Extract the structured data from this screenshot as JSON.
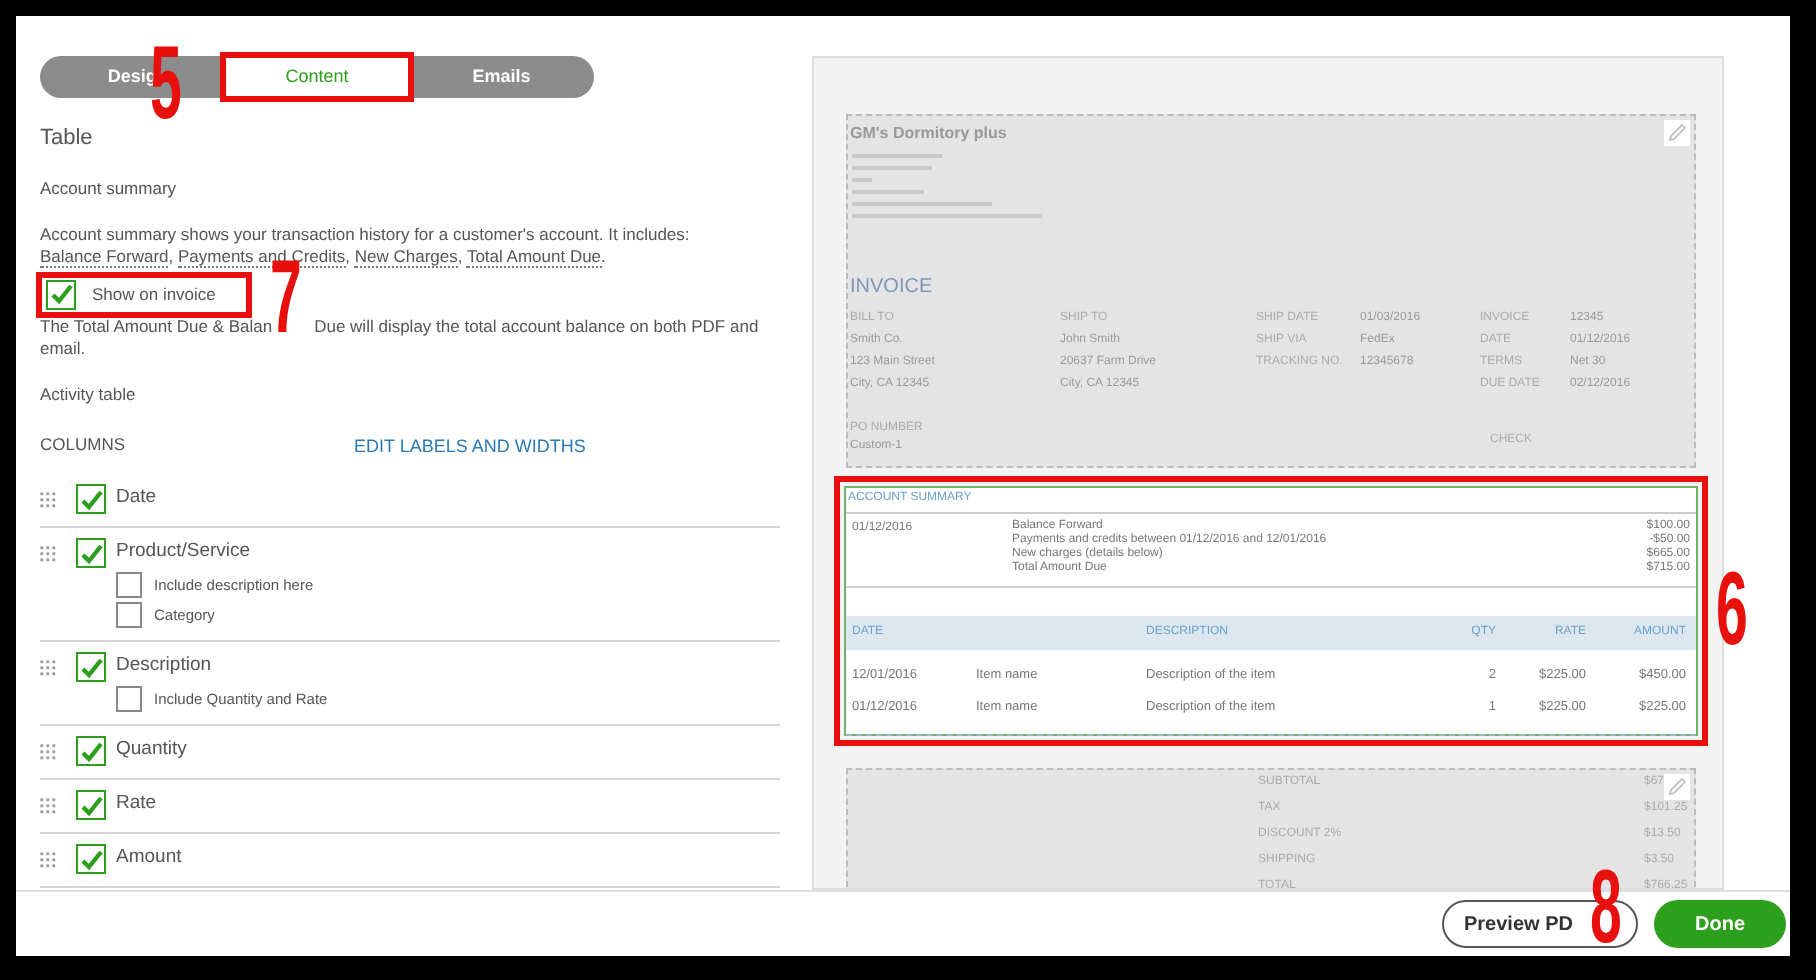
{
  "tabs": [
    {
      "label": "Desig",
      "selected": false,
      "highlighted": false
    },
    {
      "label": "Content",
      "selected": true,
      "highlighted": true
    },
    {
      "label": "Emails",
      "selected": false,
      "highlighted": false
    }
  ],
  "section_title": "Table",
  "account_summary": {
    "heading": "Account summary",
    "description": "Account summary shows your transaction history for a customer's account. It includes:",
    "terms": [
      {
        "text": "Balance Forward",
        "suffix": ","
      },
      {
        "text": "Payments and Credits",
        "suffix": ","
      },
      {
        "text": "New Charges",
        "suffix": ","
      },
      {
        "text": "Total Amount Due",
        "suffix": "."
      }
    ],
    "show_on_invoice": {
      "label": "Show on invoice",
      "checked": true,
      "highlighted": true
    },
    "note_lines": [
      {
        "kind": "before_mark",
        "text": "The Total Amount Due & Balan"
      },
      {
        "kind": "after_mark",
        "text": "Due will display the total account balance on both PDF and"
      },
      {
        "kind": "line",
        "text": "email."
      }
    ]
  },
  "activity_table": {
    "heading": "Activity table",
    "columns_label": "COLUMNS",
    "edit_link": "EDIT LABELS AND WIDTHS",
    "columns": [
      {
        "label": "Date",
        "checked": true
      },
      {
        "label": "Product/Service",
        "checked": true,
        "options": [
          {
            "label": "Include description here",
            "checked": false
          },
          {
            "label": "Category",
            "checked": false
          }
        ]
      },
      {
        "label": "Description",
        "checked": true,
        "options": [
          {
            "label": "Include Quantity and Rate",
            "checked": false
          }
        ]
      },
      {
        "label": "Quantity",
        "checked": true
      },
      {
        "label": "Rate",
        "checked": true
      },
      {
        "label": "Amount",
        "checked": true
      }
    ]
  },
  "preview": {
    "company": "GM's Dormitory plus",
    "title": "INVOICE",
    "bill_to": {
      "label": "BILL TO",
      "lines": [
        "Smith Co.",
        "123 Main Street",
        "City, CA 12345"
      ]
    },
    "ship_to": {
      "label": "SHIP TO",
      "lines": [
        "John Smith",
        "20637 Farm Drive",
        "City, CA 12345"
      ]
    },
    "ship_fields": [
      {
        "label": "SHIP DATE",
        "value": "01/03/2016"
      },
      {
        "label": "SHIP VIA",
        "value": "FedEx"
      },
      {
        "label": "TRACKING NO.",
        "value": "12345678"
      }
    ],
    "invoice_fields": [
      {
        "label": "INVOICE",
        "value": "12345"
      },
      {
        "label": "DATE",
        "value": "01/12/2016"
      },
      {
        "label": "TERMS",
        "value": "Net 30"
      },
      {
        "label": "DUE DATE",
        "value": "02/12/2016"
      }
    ],
    "po": {
      "label": "PO NUMBER",
      "value": "Custom-1"
    },
    "check": "CHECK",
    "account_summary": {
      "title": "ACCOUNT SUMMARY",
      "highlighted": true,
      "date": "01/12/2016",
      "lines": [
        {
          "label": "Balance Forward",
          "amount": "$100.00"
        },
        {
          "label": "Payments and credits between 01/12/2016 and 12/01/2016",
          "amount": "-$50.00"
        },
        {
          "label": "New charges (details below)",
          "amount": "$665.00"
        },
        {
          "label": "Total Amount Due",
          "amount": "$715.00"
        }
      ]
    },
    "activity": {
      "columns": [
        {
          "label": "DATE",
          "kind": "text"
        },
        {
          "kind": "text"
        },
        {
          "label": "DESCRIPTION",
          "kind": "text"
        },
        {
          "label": "QTY",
          "kind": "number"
        },
        {
          "label": "RATE",
          "kind": "number"
        },
        {
          "label": "AMOUNT",
          "kind": "number"
        }
      ],
      "rows": [
        [
          "12/01/2016",
          "Item name",
          "Description of the item",
          "2",
          "$225.00",
          "$450.00"
        ],
        [
          "01/12/2016",
          "Item name",
          "Description of the item",
          "1",
          "$225.00",
          "$225.00"
        ]
      ]
    },
    "totals": [
      {
        "label": "SUBTOTAL",
        "value": "$67"
      },
      {
        "label": "TAX",
        "value": "$101.25"
      },
      {
        "label": "DISCOUNT 2%",
        "value": "$13.50"
      },
      {
        "label": "SHIPPING",
        "value": "$3.50"
      },
      {
        "label": "TOTAL",
        "value": "$766.25"
      }
    ]
  },
  "footer": {
    "preview_button": "Preview PD",
    "done_button": "Done"
  },
  "annotations": [
    {
      "label": "5",
      "kind": "tabs"
    },
    {
      "label": "7",
      "kind": "checkbox"
    },
    {
      "label": "6",
      "kind": "summary"
    },
    {
      "label": "8",
      "kind": "footer"
    }
  ]
}
